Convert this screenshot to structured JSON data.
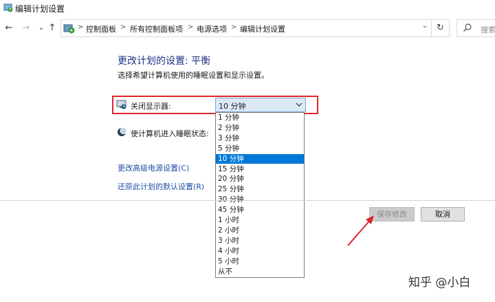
{
  "window": {
    "title": "编辑计划设置"
  },
  "navigation": {
    "back_icon": "←",
    "forward_icon": "→",
    "recent_icon": "⌄",
    "up_icon": "↑",
    "breadcrumb": [
      "控制面板",
      "所有控制面板项",
      "电源选项",
      "编辑计划设置"
    ],
    "separator": ">",
    "dropdown_icon": "⌄",
    "refresh_icon": "↻",
    "search_placeholder": "搜索"
  },
  "main": {
    "heading": "更改计划的设置: 平衡",
    "subheading": "选择希望计算机使用的睡眠设置和显示设置。",
    "settings": [
      {
        "label": "关闭显示器:",
        "icon": "monitor-icon",
        "value": "10 分钟"
      },
      {
        "label": "使计算机进入睡眠状态:",
        "icon": "moon-icon"
      }
    ],
    "dropdown_options": [
      "1 分钟",
      "2 分钟",
      "3 分钟",
      "5 分钟",
      "10 分钟",
      "15 分钟",
      "20 分钟",
      "25 分钟",
      "30 分钟",
      "45 分钟",
      "1 小时",
      "2 小时",
      "3 小时",
      "4 小时",
      "5 小时",
      "从不"
    ],
    "selected_option": "10 分钟",
    "links": [
      "更改高级电源设置(C)",
      "还原此计划的默认设置(R)"
    ]
  },
  "buttons": {
    "save": "保存修改",
    "cancel": "取消"
  },
  "colors": {
    "highlight": "#e0262c",
    "heading": "#1e3287",
    "link": "#1f4fa3",
    "selected": "#0078d7"
  },
  "watermark": "知乎 @小白"
}
